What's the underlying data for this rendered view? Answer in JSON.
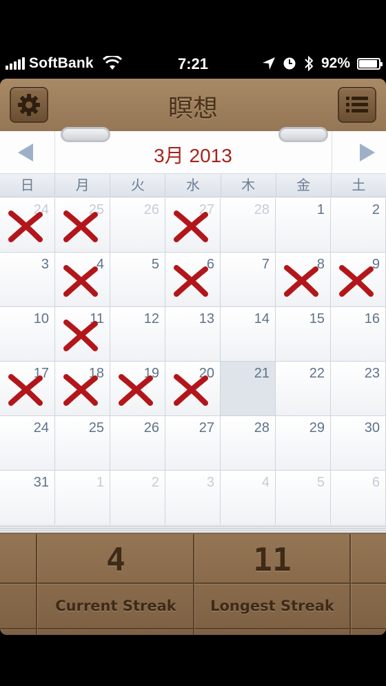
{
  "status_bar": {
    "carrier": "SoftBank",
    "time": "7:21",
    "battery_percent": "92%",
    "battery_level": 0.92,
    "icons": [
      "signal-icon",
      "wifi-icon",
      "location-icon",
      "alarm-icon",
      "bluetooth-icon",
      "battery-icon"
    ]
  },
  "header": {
    "title": "瞑想",
    "left_button_icon": "gear-icon",
    "right_button_icon": "list-icon"
  },
  "calendar": {
    "month_title": "3月 2013",
    "weekdays": [
      "日",
      "月",
      "火",
      "水",
      "木",
      "金",
      "土"
    ],
    "accent_color": "#a5231c",
    "weeks": [
      [
        {
          "d": "24",
          "other": true,
          "x": true
        },
        {
          "d": "25",
          "other": true,
          "x": true
        },
        {
          "d": "26",
          "other": true
        },
        {
          "d": "27",
          "other": true,
          "x": true
        },
        {
          "d": "28",
          "other": true
        },
        {
          "d": "1"
        },
        {
          "d": "2"
        }
      ],
      [
        {
          "d": "3"
        },
        {
          "d": "4",
          "x": true
        },
        {
          "d": "5"
        },
        {
          "d": "6",
          "x": true
        },
        {
          "d": "7"
        },
        {
          "d": "8",
          "x": true
        },
        {
          "d": "9",
          "x": true
        }
      ],
      [
        {
          "d": "10"
        },
        {
          "d": "11",
          "x": true
        },
        {
          "d": "12"
        },
        {
          "d": "13"
        },
        {
          "d": "14"
        },
        {
          "d": "15"
        },
        {
          "d": "16"
        }
      ],
      [
        {
          "d": "17",
          "x": true
        },
        {
          "d": "18",
          "x": true
        },
        {
          "d": "19",
          "x": true
        },
        {
          "d": "20",
          "x": true
        },
        {
          "d": "21",
          "today": true
        },
        {
          "d": "22"
        },
        {
          "d": "23"
        }
      ],
      [
        {
          "d": "24"
        },
        {
          "d": "25"
        },
        {
          "d": "26"
        },
        {
          "d": "27"
        },
        {
          "d": "28"
        },
        {
          "d": "29"
        },
        {
          "d": "30"
        }
      ],
      [
        {
          "d": "31"
        },
        {
          "d": "1",
          "other": true
        },
        {
          "d": "2",
          "other": true
        },
        {
          "d": "3",
          "other": true
        },
        {
          "d": "4",
          "other": true
        },
        {
          "d": "5",
          "other": true
        },
        {
          "d": "6",
          "other": true
        }
      ]
    ]
  },
  "streaks": {
    "current_value": "4",
    "current_label": "Current Streak",
    "longest_value": "11",
    "longest_label": "Longest Streak"
  }
}
